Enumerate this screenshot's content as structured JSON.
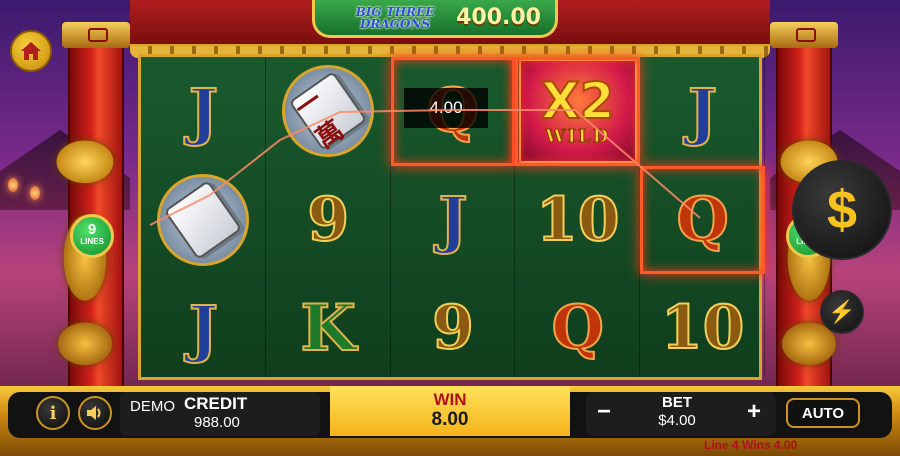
{
  "header": {
    "logo_text": "BIG THREE DRAGONS",
    "jackpot": "400.00"
  },
  "paylines_badge": {
    "count": "9",
    "label": "LINES"
  },
  "reels": [
    [
      "J",
      "mahjong",
      "J"
    ],
    [
      "mahjong",
      "9",
      "K"
    ],
    [
      "Q",
      "J",
      "9"
    ],
    [
      "WILD",
      "10",
      "Q"
    ],
    [
      "J",
      "Q",
      "10"
    ]
  ],
  "wild_symbol": {
    "multiplier": "X2",
    "label": "WILD"
  },
  "mahjong_glyph": "一\n萬",
  "win_tooltip": "4.00",
  "controls": {
    "home_icon": "home-icon",
    "spin_icon": "$",
    "turbo_icon": "⚡",
    "info_icon": "i",
    "sound_icon": "speaker-icon"
  },
  "bottom_bar": {
    "demo": "DEMO",
    "credit_label": "CREDIT",
    "credit_value": "988.00",
    "win_label": "WIN",
    "win_value": "8.00",
    "bet_minus": "−",
    "bet_label": "BET",
    "bet_value": "$4.00",
    "bet_plus": "+",
    "auto_label": "AUTO",
    "line_wins": "Line 4 Wins 4.00"
  },
  "colors": {
    "win_frame": "#ff5a2a",
    "reel_bg": "#1a5a2e",
    "gold": "#d9a52a"
  }
}
